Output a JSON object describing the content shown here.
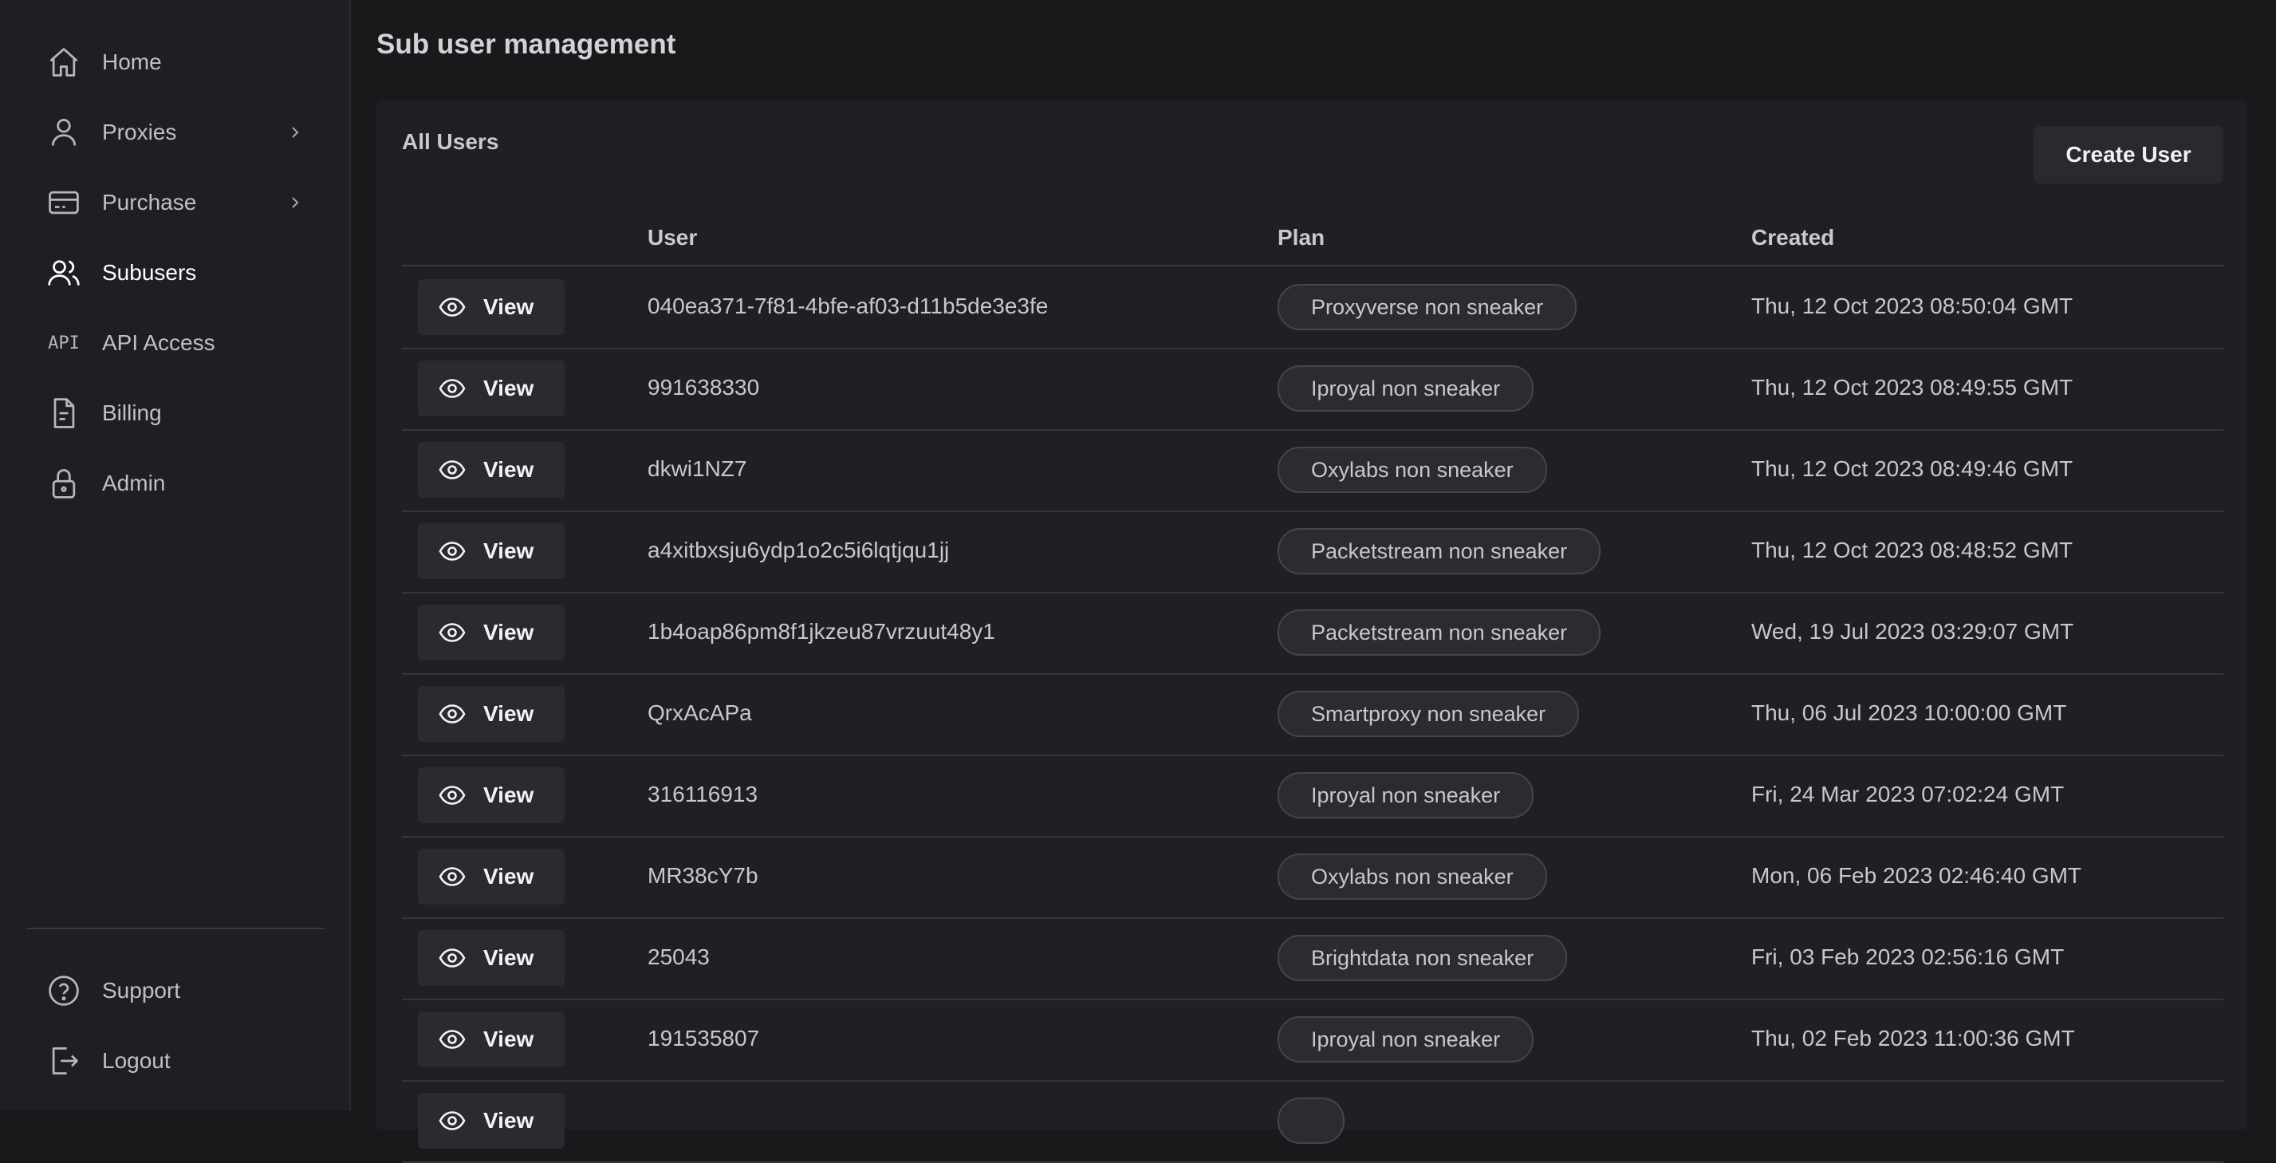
{
  "sidebar": {
    "items": [
      {
        "label": "Home",
        "icon": "home-icon"
      },
      {
        "label": "Proxies",
        "icon": "user-icon",
        "has_chevron": true
      },
      {
        "label": "Purchase",
        "icon": "credit-card-icon",
        "has_chevron": true
      },
      {
        "label": "Subusers",
        "icon": "users-icon",
        "active": true
      },
      {
        "label": "API Access",
        "icon": "api-icon",
        "icon_text": "API"
      },
      {
        "label": "Billing",
        "icon": "document-icon"
      },
      {
        "label": "Admin",
        "icon": "lock-icon"
      }
    ],
    "footer_items": [
      {
        "label": "Support",
        "icon": "help-circle-icon"
      },
      {
        "label": "Logout",
        "icon": "logout-icon"
      }
    ]
  },
  "main": {
    "title": "Sub user management",
    "card": {
      "title": "All Users",
      "create_button": "Create User",
      "columns": {
        "user": "User",
        "plan": "Plan",
        "created": "Created"
      },
      "view_label": "View",
      "rows": [
        {
          "user": "040ea371-7f81-4bfe-af03-d11b5de3e3fe",
          "plan": "Proxyverse non sneaker",
          "created": "Thu, 12 Oct 2023 08:50:04 GMT"
        },
        {
          "user": "991638330",
          "plan": "Iproyal non sneaker",
          "created": "Thu, 12 Oct 2023 08:49:55 GMT"
        },
        {
          "user": "dkwi1NZ7",
          "plan": "Oxylabs non sneaker",
          "created": "Thu, 12 Oct 2023 08:49:46 GMT"
        },
        {
          "user": "a4xitbxsju6ydp1o2c5i6lqtjqu1jj",
          "plan": "Packetstream non sneaker",
          "created": "Thu, 12 Oct 2023 08:48:52 GMT"
        },
        {
          "user": "1b4oap86pm8f1jkzeu87vrzuut48y1",
          "plan": "Packetstream non sneaker",
          "created": "Wed, 19 Jul 2023 03:29:07 GMT"
        },
        {
          "user": "QrxAcAPa",
          "plan": "Smartproxy non sneaker",
          "created": "Thu, 06 Jul 2023 10:00:00 GMT"
        },
        {
          "user": "316116913",
          "plan": "Iproyal non sneaker",
          "created": "Fri, 24 Mar 2023 07:02:24 GMT"
        },
        {
          "user": "MR38cY7b",
          "plan": "Oxylabs non sneaker",
          "created": "Mon, 06 Feb 2023 02:46:40 GMT"
        },
        {
          "user": "25043",
          "plan": "Brightdata non sneaker",
          "created": "Fri, 03 Feb 2023 02:56:16 GMT"
        },
        {
          "user": "191535807",
          "plan": "Iproyal non sneaker",
          "created": "Thu, 02 Feb 2023 11:00:36 GMT"
        },
        {
          "user": "",
          "plan": "",
          "created": ""
        }
      ]
    }
  }
}
